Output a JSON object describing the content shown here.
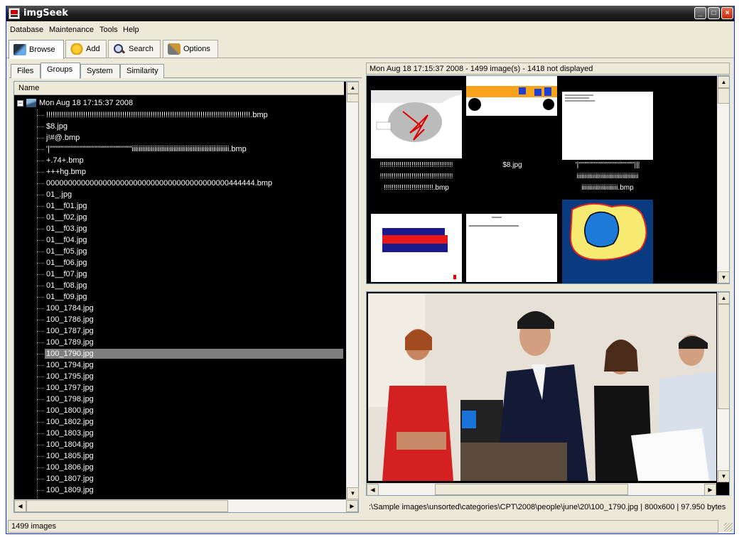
{
  "window": {
    "title": "imgSeek",
    "minimize": "_",
    "maximize": "□",
    "close": "×"
  },
  "menu": [
    "Database",
    "Maintenance",
    "Tools",
    "Help"
  ],
  "toolbar": {
    "browse": "Browse",
    "add": "Add",
    "search": "Search",
    "options": "Options"
  },
  "subtabs": [
    "Files",
    "Groups",
    "System",
    "Similarity"
  ],
  "tree": {
    "header": "Name",
    "root": "Mon Aug 18 17:15:37 2008",
    "items": [
      "!!!!!!!!!!!!!!!!!!!!!!!!!!!!!!!!!!!!!!!!!!!!!!!!!!!!!!!!!!!!!!!!!!!!!!!!!!!!!!!!!!!!!!!!!!!!!!.bmp",
      "$8.jpg",
      "j!#@.bmp",
      "'|'''''''''''''''''''''''''''''''''''''''''''''''''''''''iiiiiiiiiiiiiiiiiiiiiiiiiiiiiiiiiiiiiiiiiiiiiiiiiiiiiiii.bmp",
      "+.74+.bmp",
      "+++hg.bmp",
      "000000000000000000000000000000000000000000444444.bmp",
      "01_.jpg",
      "01__f01.jpg",
      "01__f02.jpg",
      "01__f03.jpg",
      "01__f04.jpg",
      "01__f05.jpg",
      "01__f06.jpg",
      "01__f07.jpg",
      "01__f08.jpg",
      "01__f09.jpg",
      "100_1784.jpg",
      "100_1786.jpg",
      "100_1787.jpg",
      "100_1789.jpg",
      "100_1790.jpg",
      "100_1794.jpg",
      "100_1795.jpg",
      "100_1797.jpg",
      "100_1798.jpg",
      "100_1800.jpg",
      "100_1802.jpg",
      "100_1803.jpg",
      "100_1804.jpg",
      "100_1805.jpg",
      "100_1806.jpg",
      "100_1807.jpg",
      "100_1809.jpg"
    ],
    "selected_label": "100_1790.jpg"
  },
  "thumbs": {
    "header": "Mon Aug 18 17:15:37 2008 - 1499 image(s) - 1418 not displayed",
    "captions": [
      "!!!!!!!!!!!!!!!!!!!!!!!!!!!!!!!!!!!!!\n!!!!!!!!!!!!!!!!!!!!!!!!!!!!!!!!!!!!!\n!!!!!!!!!!!!!!!!!!!!!!!!!.bmp",
      "$8.jpg",
      "'|'''''''''''''''''''''''''''''''''''''''''|||\niiiiiiiiiiiiiiiiiiiiiiiiiiiiiiiiiiiiiii\niiiiiiiiiiiiiiiiiiiiiii.bmp"
    ]
  },
  "preview": {
    "path": ":\\Sample images\\unsorted\\categories\\CPT\\2008\\people\\june\\20\\100_1790.jpg | 800x600 | 97.950 bytes"
  },
  "status": {
    "text": "1499 images"
  }
}
